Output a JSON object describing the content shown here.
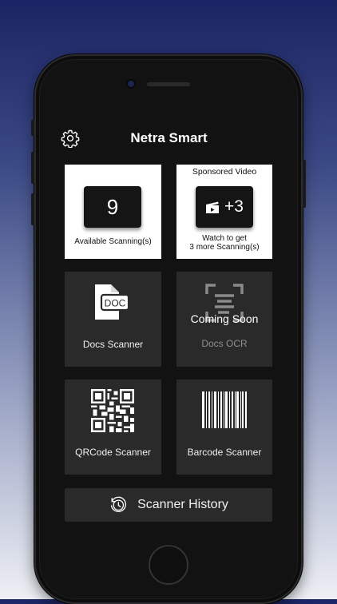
{
  "app": {
    "title": "Netra Smart"
  },
  "scan_count": {
    "value": "9",
    "label": "Available Scanning(s)"
  },
  "sponsored": {
    "header": "Sponsored Video",
    "bonus": "+3",
    "caption_line1": "Watch to get",
    "caption_line2": "3 more Scanning(s)"
  },
  "tiles": {
    "docs_scanner": {
      "label": "Docs Scanner",
      "icon": "doc-icon",
      "icon_text": "DOC"
    },
    "docs_ocr": {
      "label": "Docs OCR",
      "icon": "ocr-scan-icon",
      "overlay": "Coming Soon"
    },
    "qrcode_scanner": {
      "label": "QRCode Scanner",
      "icon": "qr-code-icon"
    },
    "barcode_scanner": {
      "label": "Barcode Scanner",
      "icon": "barcode-icon"
    }
  },
  "history": {
    "label": "Scanner History",
    "icon": "history-icon"
  },
  "colors": {
    "background_top": "#1b2464",
    "background_bottom": "#eef0f5",
    "screen": "#121213",
    "tile": "#2a2a2b",
    "card": "#ffffff"
  }
}
